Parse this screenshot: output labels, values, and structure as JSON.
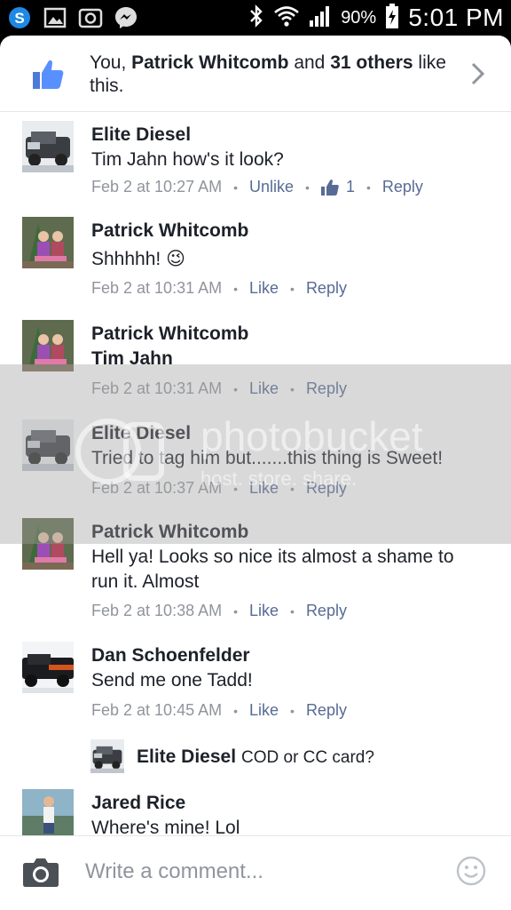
{
  "statusbar": {
    "battery": "90%",
    "time": "5:01 PM"
  },
  "likes": {
    "prefix": "You, ",
    "name": "Patrick Whitcomb",
    "middle": " and ",
    "count": "31 others",
    "suffix": " like this."
  },
  "comments": [
    {
      "name": "Elite Diesel",
      "text": "Tim Jahn how's it look?",
      "time": "Feb 2 at 10:27 AM",
      "action": "Unlike",
      "like_count": "1",
      "reply": "Reply"
    },
    {
      "name": "Patrick Whitcomb",
      "text": "Shhhhh! 😉",
      "time": "Feb 2 at 10:31 AM",
      "action": "Like",
      "reply": "Reply"
    },
    {
      "name": "Patrick Whitcomb",
      "text": "Tim Jahn",
      "time": "Feb 2 at 10:31 AM",
      "action": "Like",
      "reply": "Reply"
    },
    {
      "name": "Elite Diesel",
      "text": "Tried to tag him but.......this thing is Sweet!",
      "time": "Feb 2 at 10:37 AM",
      "action": "Like",
      "reply": "Reply"
    },
    {
      "name": "Patrick Whitcomb",
      "text": "Hell ya! Looks so nice its almost a  shame to run it. Almost",
      "time": "Feb 2 at 10:38 AM",
      "action": "Like",
      "reply": "Reply"
    },
    {
      "name": "Dan Schoenfelder",
      "text": "Send me one Tadd!",
      "time": "Feb 2 at 10:45 AM",
      "action": "Like",
      "reply": "Reply"
    },
    {
      "name": "Jared Rice",
      "text": "Where's mine! Lol"
    }
  ],
  "reply": {
    "name": "Elite Diesel",
    "text": "COD or CC card?"
  },
  "watermark": {
    "title": "photobucket",
    "subtitle": "host. store. share."
  },
  "composer": {
    "placeholder": "Write a comment..."
  }
}
